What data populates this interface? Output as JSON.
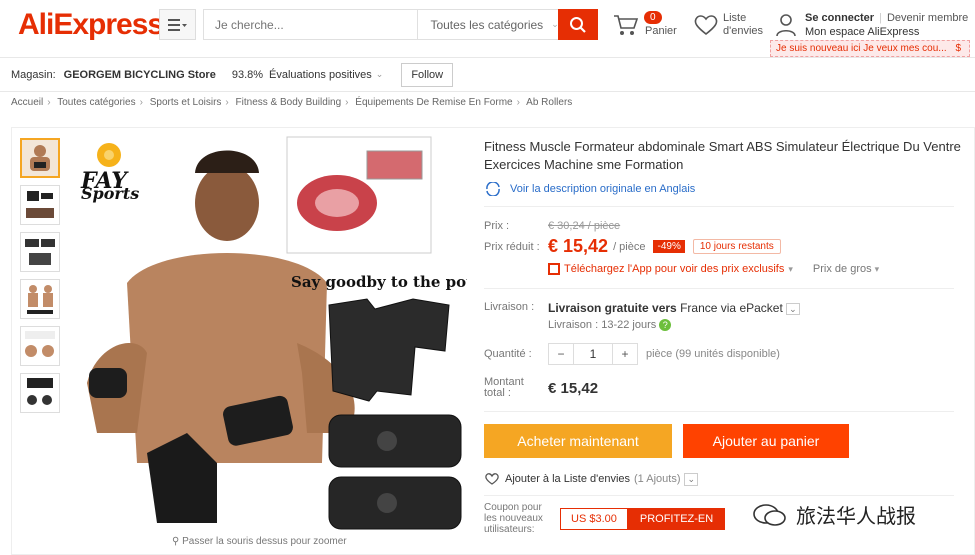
{
  "header": {
    "logo": "AliExpress",
    "search_placeholder": "Je cherche...",
    "search_category": "Toutes les catégories",
    "cart_count": "0",
    "cart_label": "Panier",
    "wishlist_line1": "Liste",
    "wishlist_line2": "d'envies",
    "signin": "Se connecter",
    "register": "Devenir membre",
    "my_account": "Mon espace AliExpress",
    "promo": "Je suis nouveau ici Je veux mes cou...",
    "promo_icon": "$"
  },
  "store": {
    "label": "Magasin:",
    "name": "GEORGEM BICYCLING Store",
    "rating": "93.8%",
    "rating_label": "Évaluations positives",
    "follow": "Follow"
  },
  "breadcrumb": [
    "Accueil",
    "Toutes catégories",
    "Sports et Loisirs",
    "Fitness & Body Building",
    "Équipements De Remise En Forme",
    "Ab Rollers"
  ],
  "gallery": {
    "brand_line1": "FAY",
    "brand_line2": "Sports",
    "caption": "Say goodby to the pot bell",
    "zoom_hint": "Passer la souris dessus pour zoomer"
  },
  "product": {
    "title": "Fitness Muscle Formateur abdominale Smart ABS Simulateur Électrique Du Ventre Exercices Machine sme Formation",
    "original_desc": "Voir la description originale en Anglais",
    "price_label": "Prix :",
    "price_orig": "€ 30,24 / pièce",
    "price_now_label": "Prix réduit :",
    "price_now": "€ 15,42",
    "price_unit": "/ pièce",
    "discount": "-49%",
    "days_left": "10 jours restants",
    "app_promo": "Téléchargez l'App pour voir des prix exclusifs",
    "wholesale": "Prix de gros",
    "delivery_label": "Livraison :",
    "delivery_main": "Livraison gratuite vers",
    "delivery_country": "France",
    "delivery_via": "via ePacket",
    "delivery_time_label": "Livraison :",
    "delivery_time": "13-22 jours",
    "qty_label": "Quantité :",
    "qty_value": "1",
    "qty_available": "pièce (99 unités disponible)",
    "total_label_1": "Montant",
    "total_label_2": "total :",
    "total": "€ 15,42",
    "buy_now": "Acheter maintenant",
    "add_to_cart": "Ajouter au panier",
    "add_wishlist": "Ajouter à la Liste d'envies",
    "wishlist_count": "(1 Ajouts)",
    "coupon_label_1": "Coupon pour",
    "coupon_label_2": "les nouveaux",
    "coupon_label_3": "utilisateurs:",
    "coupon_value": "US $3.00",
    "coupon_cta": "PROFITEZ-EN"
  },
  "watermark": "旅法华人战报",
  "colors": {
    "brand": "#e62e04",
    "buy": "#f5a623",
    "cart": "#ff4200",
    "link": "#2a6dc9"
  }
}
